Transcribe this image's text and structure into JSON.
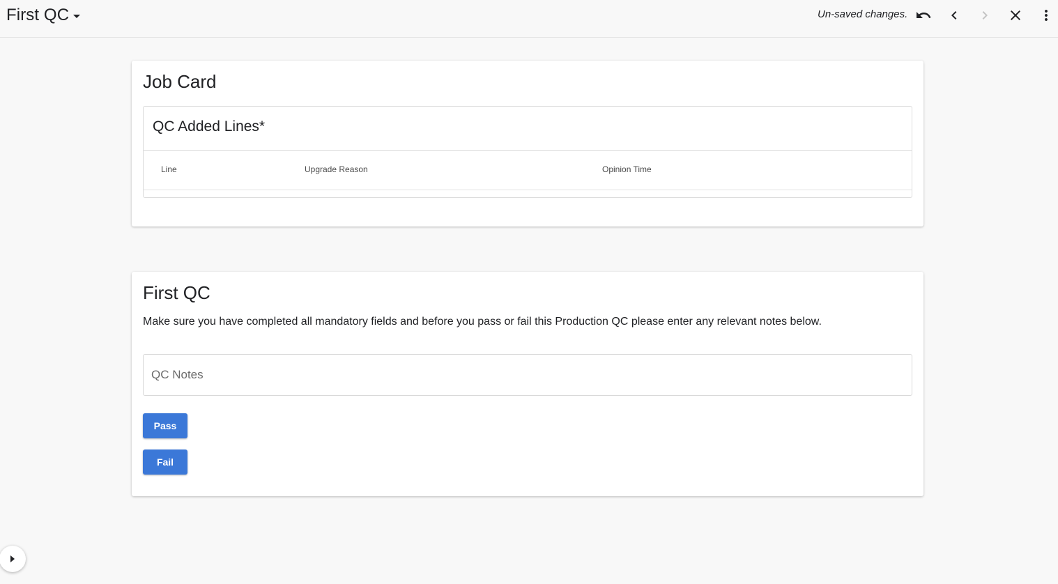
{
  "header": {
    "title": "First QC",
    "status": "Un-saved changes.",
    "icons": [
      "chevron-down-icon",
      "undo-icon",
      "chevron-left-icon",
      "chevron-right-icon",
      "close-icon",
      "more-vert-icon"
    ]
  },
  "job_card": {
    "title": "Job Card",
    "lines_panel": {
      "title": "QC Added Lines*",
      "columns": [
        "Line",
        "Upgrade Reason",
        "Opinion Time"
      ]
    }
  },
  "qc": {
    "title": "First QC",
    "description": "Make sure you have completed all mandatory fields and before you pass or fail this Production QC please enter any relevant notes below.",
    "notes_placeholder": "QC Notes",
    "notes_value": "",
    "pass_label": "Pass",
    "fail_label": "Fail"
  },
  "colors": {
    "accent": "#3b78d8",
    "background": "#f8f8f8",
    "card": "#ffffff"
  }
}
